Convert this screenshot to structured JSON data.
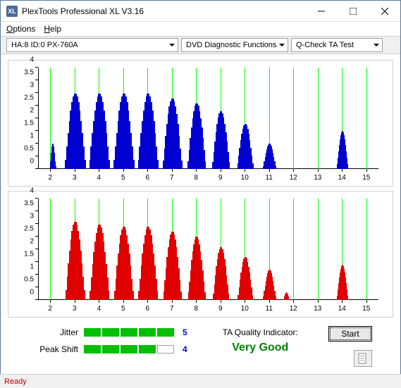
{
  "window": {
    "logo_text": "XL",
    "title": "PlexTools Professional XL V3.16"
  },
  "menu": {
    "options": "Options",
    "options_key": "O",
    "help": "Help",
    "help_key": "H"
  },
  "toolbar": {
    "drive": "HA:8 ID:0   PX-760A",
    "function": "DVD Diagnostic Functions",
    "test": "Q-Check TA Test"
  },
  "chart_data": [
    {
      "type": "bar",
      "color": "#0000d0",
      "xlim": [
        1.5,
        15.5
      ],
      "ylim": [
        0,
        4
      ],
      "yticks": [
        0,
        0.5,
        1,
        1.5,
        2,
        2.5,
        3,
        3.5,
        4
      ],
      "xticks": [
        2,
        3,
        4,
        5,
        6,
        7,
        8,
        9,
        10,
        11,
        12,
        13,
        14,
        15
      ],
      "peaks": [
        {
          "center": 2.1,
          "height": 1.0,
          "width": 0.25
        },
        {
          "center": 3.0,
          "height": 3.0,
          "width": 0.9
        },
        {
          "center": 4.0,
          "height": 3.0,
          "width": 0.9
        },
        {
          "center": 5.0,
          "height": 3.0,
          "width": 0.9
        },
        {
          "center": 6.0,
          "height": 3.0,
          "width": 0.9
        },
        {
          "center": 7.0,
          "height": 2.8,
          "width": 0.85
        },
        {
          "center": 8.0,
          "height": 2.6,
          "width": 0.8
        },
        {
          "center": 9.0,
          "height": 2.3,
          "width": 0.75
        },
        {
          "center": 10.0,
          "height": 1.8,
          "width": 0.7
        },
        {
          "center": 11.0,
          "height": 1.0,
          "width": 0.55
        },
        {
          "center": 14.0,
          "height": 1.5,
          "width": 0.5
        }
      ]
    },
    {
      "type": "bar",
      "color": "#e00000",
      "xlim": [
        1.5,
        15.5
      ],
      "ylim": [
        0,
        4
      ],
      "yticks": [
        0,
        0.5,
        1,
        1.5,
        2,
        2.5,
        3,
        3.5,
        4
      ],
      "xticks": [
        2,
        3,
        4,
        5,
        6,
        7,
        8,
        9,
        10,
        11,
        12,
        13,
        14,
        15
      ],
      "peaks": [
        {
          "center": 3.0,
          "height": 3.1,
          "width": 0.85
        },
        {
          "center": 4.0,
          "height": 3.0,
          "width": 0.85
        },
        {
          "center": 5.0,
          "height": 2.9,
          "width": 0.85
        },
        {
          "center": 6.0,
          "height": 2.9,
          "width": 0.85
        },
        {
          "center": 7.0,
          "height": 2.7,
          "width": 0.8
        },
        {
          "center": 8.0,
          "height": 2.5,
          "width": 0.75
        },
        {
          "center": 9.0,
          "height": 2.1,
          "width": 0.7
        },
        {
          "center": 10.0,
          "height": 1.7,
          "width": 0.65
        },
        {
          "center": 11.0,
          "height": 1.2,
          "width": 0.55
        },
        {
          "center": 11.7,
          "height": 0.3,
          "width": 0.25
        },
        {
          "center": 14.0,
          "height": 1.4,
          "width": 0.5
        }
      ]
    }
  ],
  "metrics": {
    "jitter_label": "Jitter",
    "jitter_value": "5",
    "jitter_filled": 5,
    "peakshift_label": "Peak Shift",
    "peakshift_value": "4",
    "peakshift_filled": 4
  },
  "quality": {
    "label": "TA Quality Indicator:",
    "value": "Very Good"
  },
  "buttons": {
    "start": "Start"
  },
  "status": {
    "text": "Ready"
  }
}
